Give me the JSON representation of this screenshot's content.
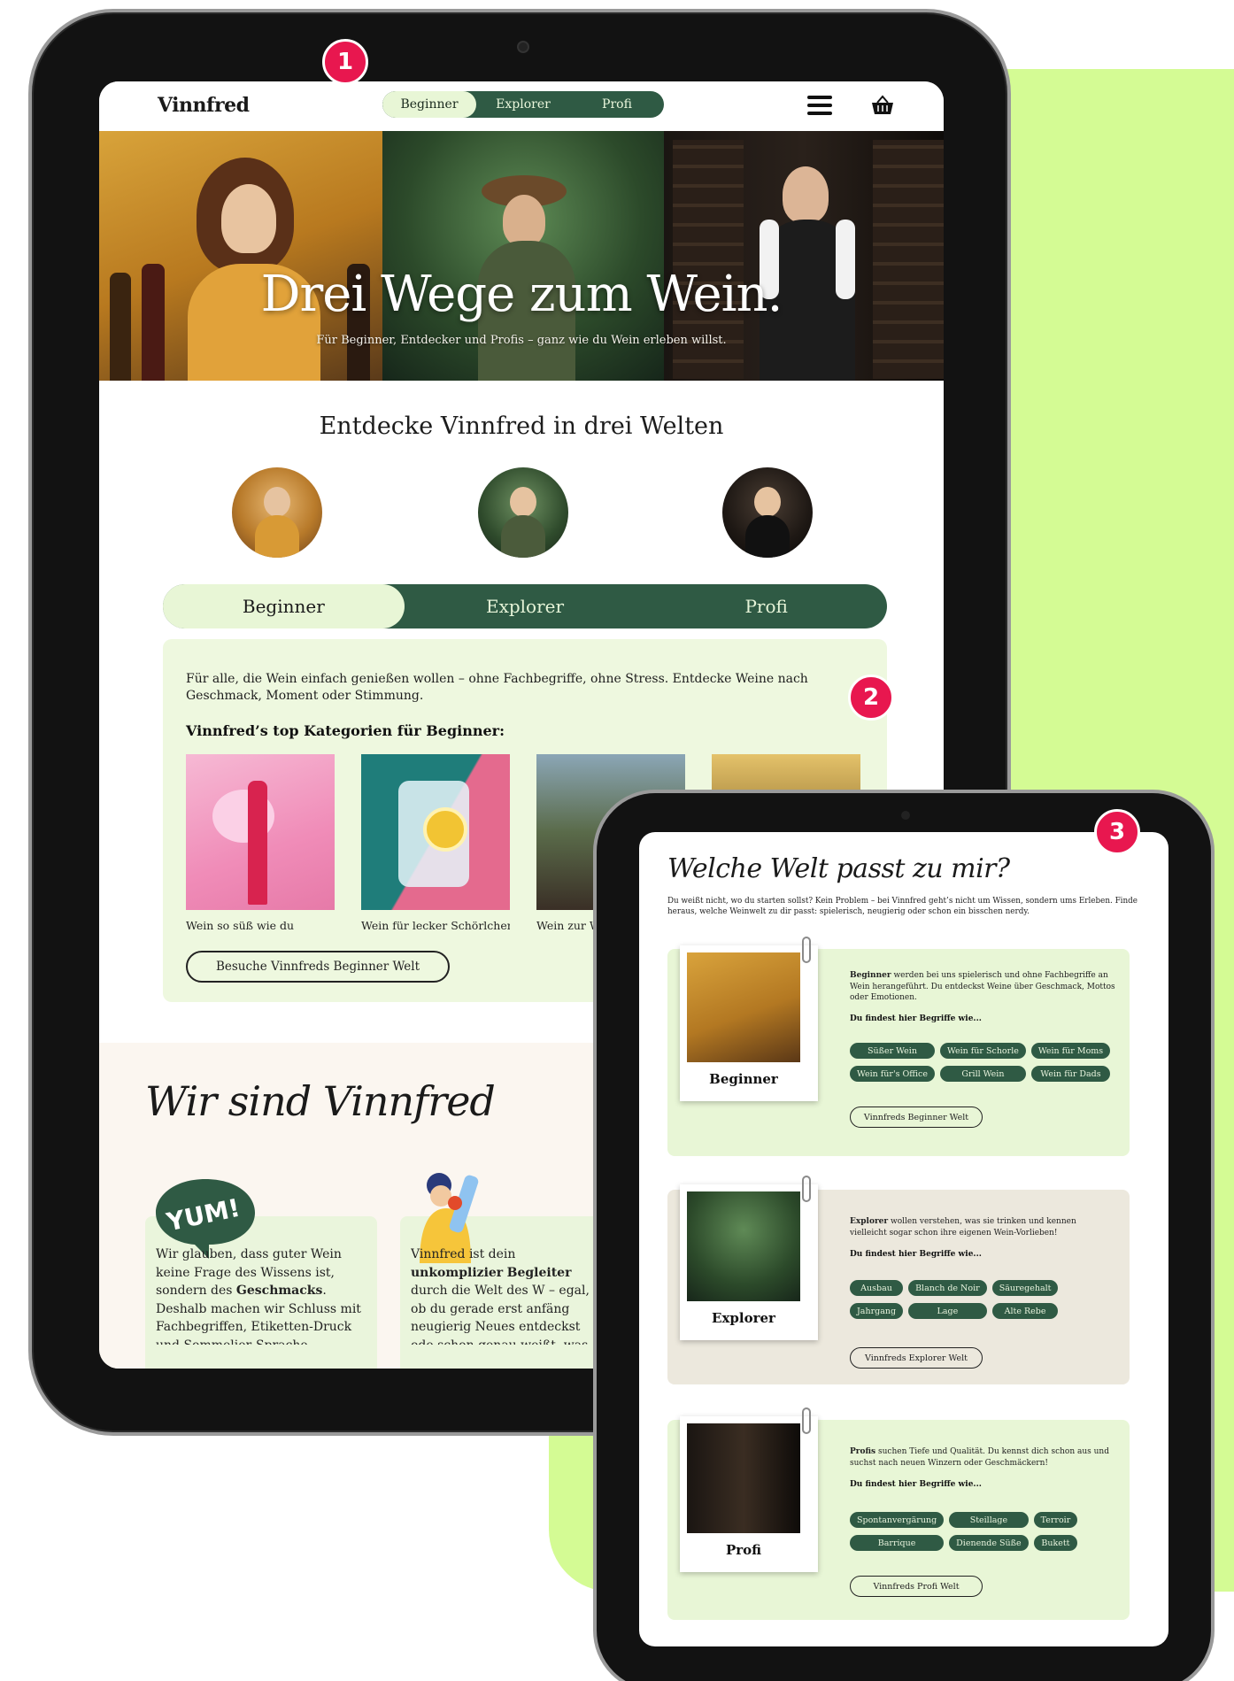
{
  "colors": {
    "accent_green": "#2f5a44",
    "pale_green": "#eef8df",
    "lime_bg": "#d4fb94",
    "badge_pink": "#e8174f",
    "explorer_beige": "#ece8dd"
  },
  "badges": [
    "1",
    "2",
    "3"
  ],
  "nav": {
    "logo": "Vinnfred",
    "tabs": [
      {
        "label": "Beginner",
        "active": true
      },
      {
        "label": "Explorer",
        "active": false
      },
      {
        "label": "Profi",
        "active": false
      }
    ],
    "menu_icon": "hamburger-icon",
    "cart_icon": "basket-icon"
  },
  "hero": {
    "title": "Drei Wege zum Wein.",
    "subtitle": "Für Beginner, Entdecker und Profis – ganz wie du Wein erleben willst."
  },
  "worlds_section": {
    "title": "Entdecke Vinnfred in drei Welten",
    "tabs": [
      {
        "label": "Beginner",
        "active": true
      },
      {
        "label": "Explorer",
        "active": false
      },
      {
        "label": "Profi",
        "active": false
      }
    ],
    "panel": {
      "description": "Für alle, die Wein einfach genießen wollen – ohne Fachbegriffe, ohne Stress. Entdecke Weine nach Geschmack, Moment oder Stimmung.",
      "heading": "Vinnfred’s top Kategorien für Beginner:",
      "categories": [
        {
          "label": "Wein so süß wie du"
        },
        {
          "label": "Wein für lecker Schörlchen"
        },
        {
          "label": "Wein zur W"
        },
        {
          "label": ""
        }
      ],
      "button": "Besuche Vinnfreds Beginner Welt"
    }
  },
  "about": {
    "title": "Wir sind Vinnfred",
    "yum_label": "YUM!",
    "card1_parts": [
      "Wir glauben, dass guter Wein keine Frage des Wissens ist, sondern des ",
      "Geschmacks",
      ". Deshalb machen wir Schluss mit Fachbegriffen, Etiketten-Druck und Sommelier-Sprache."
    ],
    "card2_parts": [
      "Vinnfred ist dein ",
      "unkomplizier",
      " ",
      "Begleiter",
      " durch die Welt des W – egal, ob du gerade erst anfäng neugierig Neues entdeckst ode schon genau weißt, was du such"
    ]
  },
  "mobile": {
    "title": "Welche Welt passt zu mir?",
    "description": "Du weißt nicht, wo du starten sollst? Kein Problem – bei Vinnfred geht’s nicht um Wissen, sondern ums Erleben. Finde heraus, welche Weinwelt zu dir passt: spielerisch, neugierig oder schon ein bisschen nerdy.",
    "worlds": [
      {
        "name": "Beginner",
        "lead": "Beginner",
        "text": " werden bei uns spielerisch und ohne Fachbegriffe an Wein herangeführt. Du entdeckst Weine über Geschmack, Mottos oder Emotionen.",
        "terms_heading": "Du findest hier Begriffe wie...",
        "chips": [
          "Süßer Wein",
          "Wein für Schorle",
          "Wein für Moms",
          "Wein für's Office",
          "Grill Wein",
          "Wein für Dads"
        ],
        "button": "Vinnfreds Beginner Welt"
      },
      {
        "name": "Explorer",
        "lead": "Explorer",
        "text": " wollen verstehen, was sie trinken und kennen vielleicht sogar schon ihre eigenen Wein-Vorlieben!",
        "terms_heading": "Du findest hier Begriffe wie...",
        "chips": [
          "Ausbau",
          "Blanch de Noir",
          "Säuregehalt",
          "Jahrgang",
          "Lage",
          "Alte Rebe"
        ],
        "button": "Vinnfreds Explorer Welt"
      },
      {
        "name": "Profi",
        "lead": "Profis",
        "text": " suchen Tiefe und Qualität. Du kennst dich schon aus und suchst nach neuen Winzern oder Geschmäckern!",
        "terms_heading": "Du findest hier Begriffe wie...",
        "chips": [
          "Spontanvergärung",
          "Steillage",
          "Terroir",
          "Barrique",
          "Dienende Süße",
          "Bukett"
        ],
        "button": "Vinnfreds Profi Welt"
      }
    ]
  }
}
